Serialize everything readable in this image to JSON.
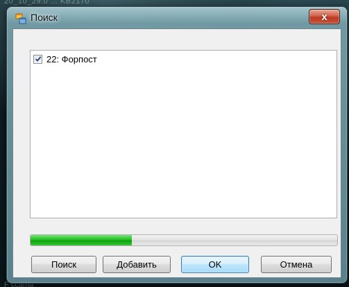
{
  "backdrop": {
    "top_text": "20_10_29.0 ... KB2170",
    "bottom_text": "F ccama"
  },
  "window": {
    "title": "Поиск",
    "close_glyph": "x",
    "icon": "application-window-icon"
  },
  "list": {
    "items": [
      {
        "label": "22: Форпост",
        "checked": true
      }
    ]
  },
  "progress": {
    "fraction": 0.33,
    "fill_color": "#22c022"
  },
  "buttons": {
    "search": "Поиск",
    "add": "Добавить",
    "ok": "OK",
    "cancel": "Отмена"
  }
}
